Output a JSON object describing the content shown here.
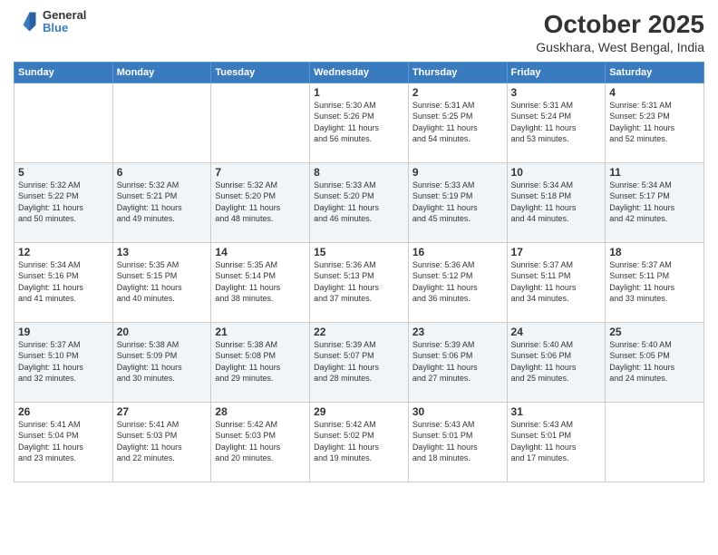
{
  "header": {
    "logo": {
      "general": "General",
      "blue": "Blue"
    },
    "title": "October 2025",
    "subtitle": "Guskhara, West Bengal, India"
  },
  "weekdays": [
    "Sunday",
    "Monday",
    "Tuesday",
    "Wednesday",
    "Thursday",
    "Friday",
    "Saturday"
  ],
  "weeks": [
    [
      {
        "day": "",
        "info": ""
      },
      {
        "day": "",
        "info": ""
      },
      {
        "day": "",
        "info": ""
      },
      {
        "day": "1",
        "info": "Sunrise: 5:30 AM\nSunset: 5:26 PM\nDaylight: 11 hours\nand 56 minutes."
      },
      {
        "day": "2",
        "info": "Sunrise: 5:31 AM\nSunset: 5:25 PM\nDaylight: 11 hours\nand 54 minutes."
      },
      {
        "day": "3",
        "info": "Sunrise: 5:31 AM\nSunset: 5:24 PM\nDaylight: 11 hours\nand 53 minutes."
      },
      {
        "day": "4",
        "info": "Sunrise: 5:31 AM\nSunset: 5:23 PM\nDaylight: 11 hours\nand 52 minutes."
      }
    ],
    [
      {
        "day": "5",
        "info": "Sunrise: 5:32 AM\nSunset: 5:22 PM\nDaylight: 11 hours\nand 50 minutes."
      },
      {
        "day": "6",
        "info": "Sunrise: 5:32 AM\nSunset: 5:21 PM\nDaylight: 11 hours\nand 49 minutes."
      },
      {
        "day": "7",
        "info": "Sunrise: 5:32 AM\nSunset: 5:20 PM\nDaylight: 11 hours\nand 48 minutes."
      },
      {
        "day": "8",
        "info": "Sunrise: 5:33 AM\nSunset: 5:20 PM\nDaylight: 11 hours\nand 46 minutes."
      },
      {
        "day": "9",
        "info": "Sunrise: 5:33 AM\nSunset: 5:19 PM\nDaylight: 11 hours\nand 45 minutes."
      },
      {
        "day": "10",
        "info": "Sunrise: 5:34 AM\nSunset: 5:18 PM\nDaylight: 11 hours\nand 44 minutes."
      },
      {
        "day": "11",
        "info": "Sunrise: 5:34 AM\nSunset: 5:17 PM\nDaylight: 11 hours\nand 42 minutes."
      }
    ],
    [
      {
        "day": "12",
        "info": "Sunrise: 5:34 AM\nSunset: 5:16 PM\nDaylight: 11 hours\nand 41 minutes."
      },
      {
        "day": "13",
        "info": "Sunrise: 5:35 AM\nSunset: 5:15 PM\nDaylight: 11 hours\nand 40 minutes."
      },
      {
        "day": "14",
        "info": "Sunrise: 5:35 AM\nSunset: 5:14 PM\nDaylight: 11 hours\nand 38 minutes."
      },
      {
        "day": "15",
        "info": "Sunrise: 5:36 AM\nSunset: 5:13 PM\nDaylight: 11 hours\nand 37 minutes."
      },
      {
        "day": "16",
        "info": "Sunrise: 5:36 AM\nSunset: 5:12 PM\nDaylight: 11 hours\nand 36 minutes."
      },
      {
        "day": "17",
        "info": "Sunrise: 5:37 AM\nSunset: 5:11 PM\nDaylight: 11 hours\nand 34 minutes."
      },
      {
        "day": "18",
        "info": "Sunrise: 5:37 AM\nSunset: 5:11 PM\nDaylight: 11 hours\nand 33 minutes."
      }
    ],
    [
      {
        "day": "19",
        "info": "Sunrise: 5:37 AM\nSunset: 5:10 PM\nDaylight: 11 hours\nand 32 minutes."
      },
      {
        "day": "20",
        "info": "Sunrise: 5:38 AM\nSunset: 5:09 PM\nDaylight: 11 hours\nand 30 minutes."
      },
      {
        "day": "21",
        "info": "Sunrise: 5:38 AM\nSunset: 5:08 PM\nDaylight: 11 hours\nand 29 minutes."
      },
      {
        "day": "22",
        "info": "Sunrise: 5:39 AM\nSunset: 5:07 PM\nDaylight: 11 hours\nand 28 minutes."
      },
      {
        "day": "23",
        "info": "Sunrise: 5:39 AM\nSunset: 5:06 PM\nDaylight: 11 hours\nand 27 minutes."
      },
      {
        "day": "24",
        "info": "Sunrise: 5:40 AM\nSunset: 5:06 PM\nDaylight: 11 hours\nand 25 minutes."
      },
      {
        "day": "25",
        "info": "Sunrise: 5:40 AM\nSunset: 5:05 PM\nDaylight: 11 hours\nand 24 minutes."
      }
    ],
    [
      {
        "day": "26",
        "info": "Sunrise: 5:41 AM\nSunset: 5:04 PM\nDaylight: 11 hours\nand 23 minutes."
      },
      {
        "day": "27",
        "info": "Sunrise: 5:41 AM\nSunset: 5:03 PM\nDaylight: 11 hours\nand 22 minutes."
      },
      {
        "day": "28",
        "info": "Sunrise: 5:42 AM\nSunset: 5:03 PM\nDaylight: 11 hours\nand 20 minutes."
      },
      {
        "day": "29",
        "info": "Sunrise: 5:42 AM\nSunset: 5:02 PM\nDaylight: 11 hours\nand 19 minutes."
      },
      {
        "day": "30",
        "info": "Sunrise: 5:43 AM\nSunset: 5:01 PM\nDaylight: 11 hours\nand 18 minutes."
      },
      {
        "day": "31",
        "info": "Sunrise: 5:43 AM\nSunset: 5:01 PM\nDaylight: 11 hours\nand 17 minutes."
      },
      {
        "day": "",
        "info": ""
      }
    ]
  ]
}
